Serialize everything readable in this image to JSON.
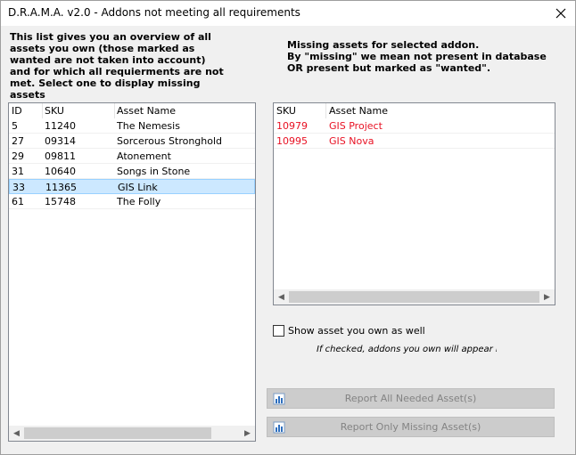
{
  "window": {
    "title": "D.R.A.M.A. v2.0 - Addons not meeting all requirements"
  },
  "left_description": "This list gives you an overview of all assets you own (those marked as wanted are not taken into account) and for which all requierments are not met. Select one to display missing assets",
  "right_description": "Missing assets for selected addon.\nBy \"missing\" we mean not present in database OR present but marked as \"wanted\".",
  "addons_list": {
    "columns": [
      "ID",
      "SKU",
      "Asset Name"
    ],
    "rows": [
      {
        "id": "5",
        "sku": "11240",
        "name": "The Nemesis",
        "selected": false
      },
      {
        "id": "27",
        "sku": "09314",
        "name": "Sorcerous Stronghold",
        "selected": false
      },
      {
        "id": "29",
        "sku": "09811",
        "name": "Atonement",
        "selected": false
      },
      {
        "id": "31",
        "sku": "10640",
        "name": "Songs in Stone",
        "selected": false
      },
      {
        "id": "33",
        "sku": "11365",
        "name": "GIS Link",
        "selected": true
      },
      {
        "id": "61",
        "sku": "15748",
        "name": "The Folly",
        "selected": false
      }
    ]
  },
  "missing_list": {
    "columns": [
      "SKU",
      "Asset Name"
    ],
    "rows": [
      {
        "sku": "10979",
        "name": "GIS Project"
      },
      {
        "sku": "10995",
        "name": "GIS Nova"
      }
    ],
    "missing_color": "#e81123"
  },
  "show_owned": {
    "label": "Show asset you own as well",
    "checked": false
  },
  "hint": "If checked, addons you own will appear in green",
  "buttons": {
    "report_all": "Report All Needed Asset(s)",
    "report_missing": "Report Only Missing Asset(s)"
  },
  "icons": {
    "close": "close-icon",
    "scroll_left": "chevron-left-icon",
    "scroll_right": "chevron-right-icon",
    "report": "report-icon"
  }
}
